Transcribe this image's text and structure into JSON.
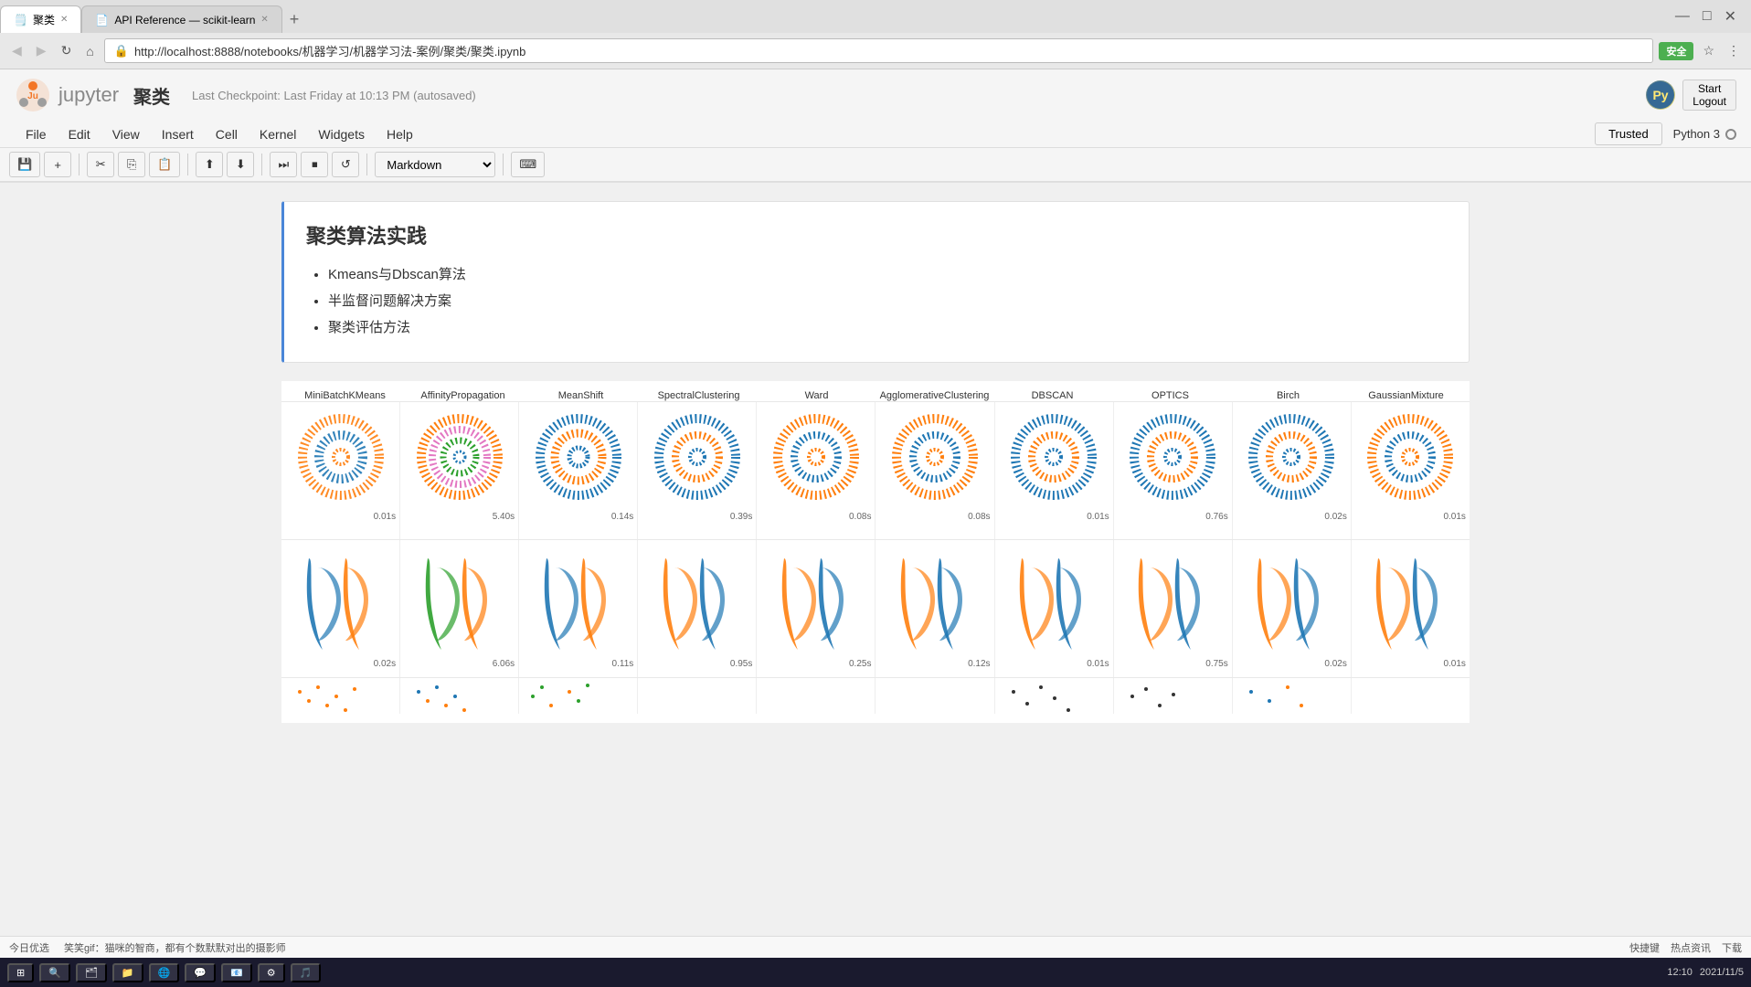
{
  "browser": {
    "title_bar": {
      "tabs": [
        {
          "label": "聚类",
          "favicon": "🗒️",
          "active": true,
          "closeable": true
        },
        {
          "label": "API Reference — scikit-learn",
          "favicon": "📄",
          "active": false,
          "closeable": true
        }
      ],
      "new_tab_label": "+"
    },
    "address_bar": {
      "url": "http://localhost:8888/notebooks/机器学习/机器学习法-案例/聚类/聚类.ipynb",
      "secure_badge": "安全",
      "secure_color": "#4caf50"
    }
  },
  "jupyter": {
    "logo_text": "jupyter",
    "notebook_title": "聚类",
    "checkpoint_text": "Last Checkpoint: Last Friday at 10:13 PM (autosaved)",
    "user": {
      "start_label": "Start",
      "logout_label": "Logout"
    },
    "kernel_name": "Python 3"
  },
  "menu": {
    "items": [
      "File",
      "Edit",
      "View",
      "Insert",
      "Cell",
      "Kernel",
      "Widgets",
      "Help"
    ],
    "trusted_label": "Trusted",
    "kernel_label": "Python 3"
  },
  "toolbar": {
    "buttons": [
      "💾",
      "+",
      "✂",
      "⎘",
      "📋",
      "⬆",
      "⬇",
      "⏭",
      "⏹",
      "↺"
    ],
    "cell_type": "Markdown",
    "keyboard_icon": "⌨"
  },
  "cell": {
    "title": "聚类算法实践",
    "items": [
      "Kmeans与Dbscan算法",
      "半监督问题解决方案",
      "聚类评估方法"
    ]
  },
  "visualization": {
    "column_labels": [
      "MiniBatchKMeans",
      "AffinityPropagation",
      "MeanShift",
      "SpectralClustering",
      "Ward",
      "AgglomerativeClustering",
      "DBSCAN",
      "OPTICS",
      "Birch",
      "GaussianMixture"
    ],
    "rows": [
      {
        "times": [
          "0.01s",
          "5.40s",
          "0.14s",
          "0.39s",
          "0.08s",
          "0.08s",
          "0.01s",
          "0.76s",
          "0.02s",
          "0.01s"
        ],
        "type": "rings"
      },
      {
        "times": [
          "0.02s",
          "6.06s",
          "0.11s",
          "0.95s",
          "0.25s",
          "0.12s",
          "0.01s",
          "0.75s",
          "0.02s",
          "0.01s"
        ],
        "type": "waves"
      }
    ]
  },
  "status_bar": {
    "left": [
      "今日优选",
      "笑笑gif：猫咪的智商，都有个数默默对出的摄影师"
    ],
    "right": [
      "快捷键",
      "热点资讯",
      "下载",
      ""
    ]
  },
  "taskbar": {
    "apps": [
      "⊞",
      "🔍",
      "🗂",
      "📁",
      "🌐",
      "💬",
      "📧",
      "⚙",
      "🎵"
    ]
  }
}
